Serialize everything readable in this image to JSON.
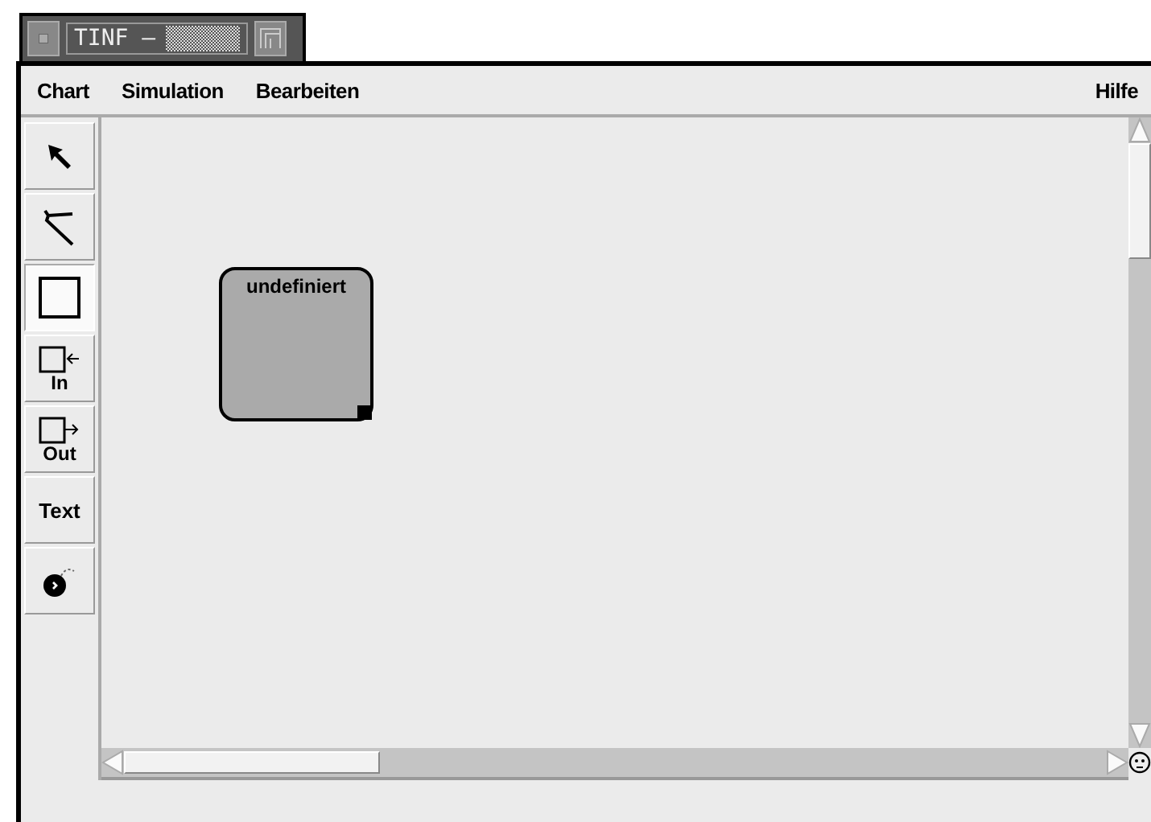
{
  "window": {
    "title": "TINF –"
  },
  "menu": {
    "left": [
      "Chart",
      "Simulation",
      "Bearbeiten"
    ],
    "right": "Hilfe"
  },
  "tools": [
    {
      "kind": "arrow",
      "selected": false
    },
    {
      "kind": "transition",
      "selected": false
    },
    {
      "kind": "state",
      "selected": true
    },
    {
      "kind": "in",
      "label": "In",
      "selected": false
    },
    {
      "kind": "out",
      "label": "Out",
      "selected": false
    },
    {
      "kind": "text",
      "label": "Text",
      "selected": false
    },
    {
      "kind": "bomb",
      "selected": false
    }
  ],
  "canvas": {
    "states": [
      {
        "label": "undefiniert"
      }
    ]
  }
}
